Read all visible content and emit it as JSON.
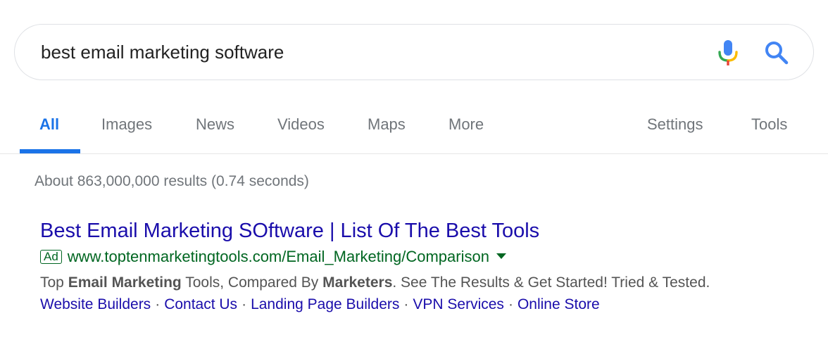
{
  "search": {
    "query": "best email marketing software"
  },
  "tabs": [
    {
      "label": "All",
      "active": true
    },
    {
      "label": "Images"
    },
    {
      "label": "News"
    },
    {
      "label": "Videos"
    },
    {
      "label": "Maps"
    },
    {
      "label": "More"
    },
    {
      "label": "Settings"
    },
    {
      "label": "Tools"
    }
  ],
  "stats": "About 863,000,000 results (0.74 seconds)",
  "ad": {
    "title": "Best Email Marketing SOftware | List Of The Best Tools",
    "badge": "Ad",
    "url": "www.toptenmarketingtools.com/Email_Marketing/Comparison",
    "snippet": {
      "p1": "Top ",
      "b1": "Email Marketing",
      "p2": " Tools, Compared By ",
      "b2": "Marketers",
      "p3": ". See The Results & Get Started! Tried & Tested."
    },
    "sitelinks": [
      "Website Builders",
      "Contact Us",
      "Landing Page Builders",
      "VPN Services",
      "Online Store"
    ],
    "separator": "·"
  },
  "colors": {
    "active_tab": "#1a73e8",
    "link": "#1a0dab",
    "url_green": "#006621",
    "muted": "#70757a"
  },
  "icons": {
    "mic": "microphone-icon",
    "search": "search-icon",
    "dropdown": "dropdown-arrow-icon"
  }
}
